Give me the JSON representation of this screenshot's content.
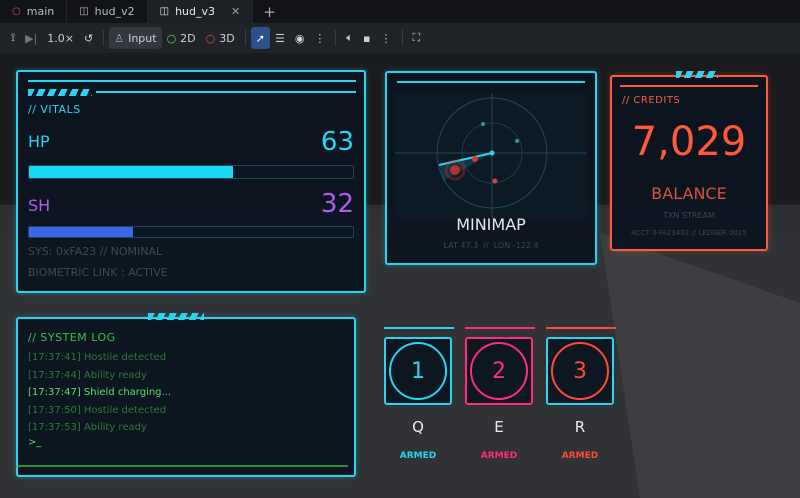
{
  "tabs": [
    {
      "label": "main",
      "icon": "circle-icon",
      "active": false
    },
    {
      "label": "hud_v2",
      "icon": "scene-icon",
      "active": false
    },
    {
      "label": "hud_v3",
      "icon": "scene-icon",
      "active": true
    }
  ],
  "toolbar": {
    "speed": "1.0×",
    "input_label": "Input",
    "mode_2d": "2D",
    "mode_3d": "3D"
  },
  "vitals": {
    "header": "// VITALS",
    "hp_label": "HP",
    "hp_value": "63",
    "hp_fraction": 0.63,
    "sh_label": "SH",
    "sh_value": "32",
    "sh_fraction": 0.32,
    "sys_line": "SYS: 0xFA23 // NOMINAL",
    "bio_line": "BIOMETRIC LINK : ACTIVE"
  },
  "minimap": {
    "title": "MINIMAP",
    "coords": "LAT 47.3  //  LON -122.4"
  },
  "credits": {
    "header": "// CREDITS",
    "amount": "7,029",
    "label": "BALANCE",
    "stream": "TXN STREAM",
    "acct": "ACCT 0·FA23402 // LEDGER 0025"
  },
  "syslog": {
    "header": "// SYSTEM LOG",
    "lines": [
      {
        "text": "[17:37:41] Hostile detected",
        "hl": false
      },
      {
        "text": "[17:37:44] Ability ready",
        "hl": false
      },
      {
        "text": "[17:37:47] Shield charging...",
        "hl": true
      },
      {
        "text": "[17:37:50] Hostile detected",
        "hl": false
      },
      {
        "text": "[17:37:53] Ability ready",
        "hl": false
      }
    ],
    "prompt": ">_"
  },
  "abilities": [
    {
      "num": "1",
      "key": "Q",
      "state": "ARMED",
      "color": "#2ad4f0"
    },
    {
      "num": "2",
      "key": "E",
      "state": "ARMED",
      "color": "#ff2d7a"
    },
    {
      "num": "3",
      "key": "R",
      "state": "ARMED",
      "color": "#ff4a3a"
    }
  ],
  "colors": {
    "cyan": "#2ad4f0",
    "orange": "#ff5a3a",
    "purple": "#b05cf0",
    "green": "#39c04a"
  }
}
